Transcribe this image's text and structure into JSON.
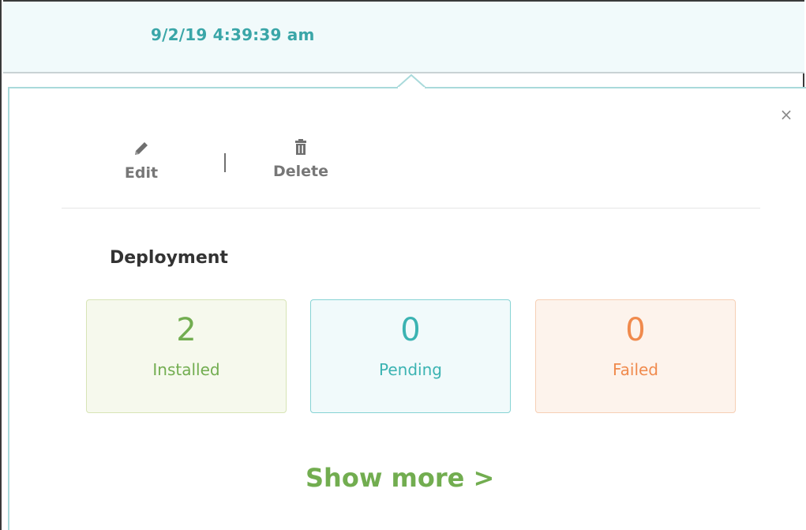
{
  "header": {
    "timestamp": "9/2/19 4:39:39 am"
  },
  "popover": {
    "close_icon": "×",
    "actions": [
      {
        "label": "Edit",
        "icon": "pencil-icon"
      },
      {
        "label": "Delete",
        "icon": "trash-icon"
      }
    ],
    "separator": "|",
    "section_title": "Deployment",
    "tiles": [
      {
        "count": "2",
        "label": "Installed",
        "color": "#72ad50"
      },
      {
        "count": "0",
        "label": "Pending",
        "color": "#3bb3b2"
      },
      {
        "count": "0",
        "label": "Failed",
        "color": "#f08a4d"
      }
    ],
    "show_more_label": "Show more >"
  }
}
